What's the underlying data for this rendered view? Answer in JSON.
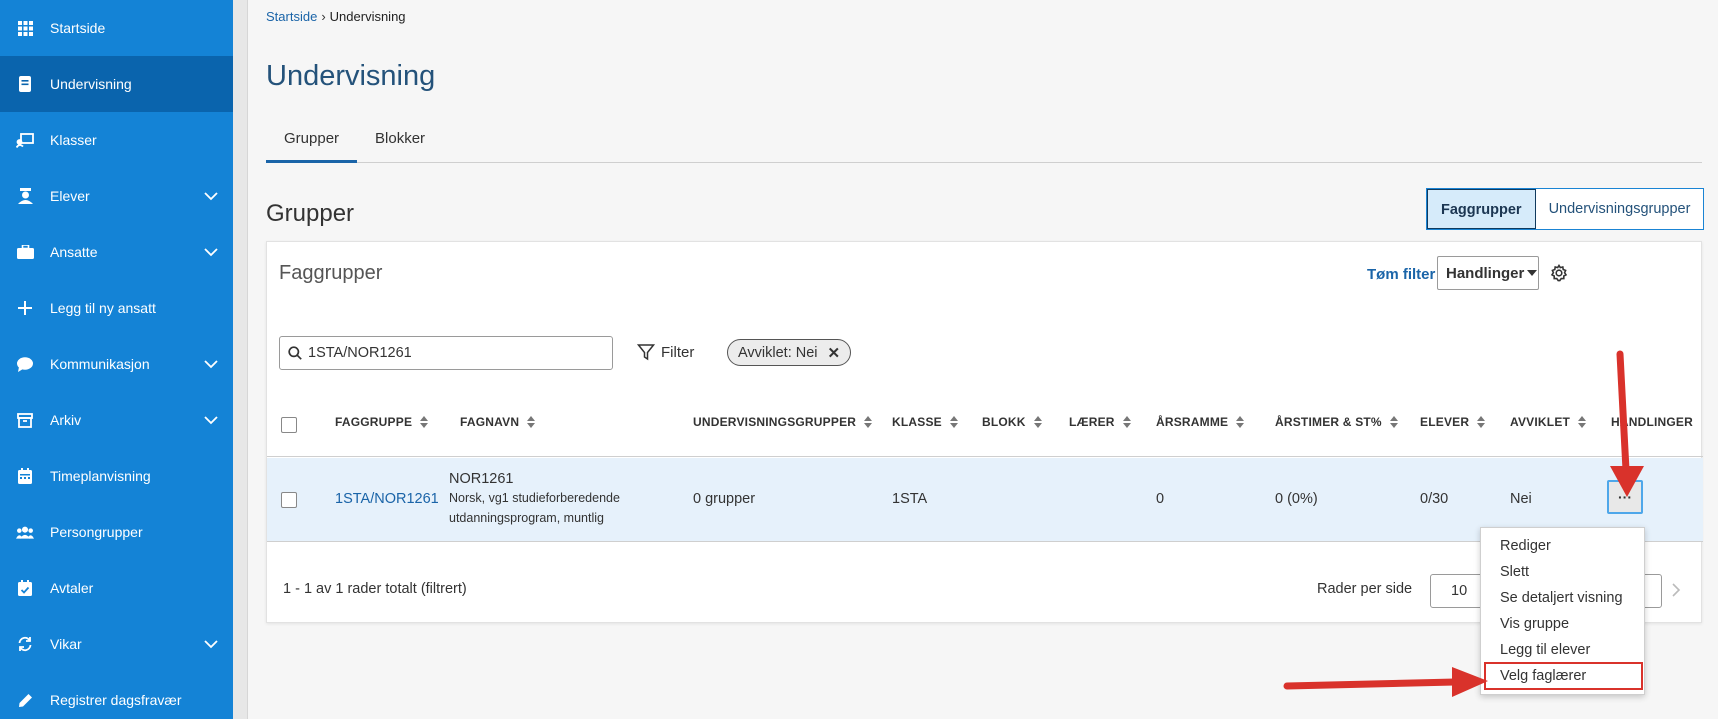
{
  "sidebar": {
    "items": [
      {
        "label": "Startside",
        "icon": "grid-icon",
        "active": false,
        "expandable": false
      },
      {
        "label": "Undervisning",
        "icon": "book-icon",
        "active": true,
        "expandable": false
      },
      {
        "label": "Klasser",
        "icon": "classroom-icon",
        "active": false,
        "expandable": false
      },
      {
        "label": "Elever",
        "icon": "student-icon",
        "active": false,
        "expandable": true
      },
      {
        "label": "Ansatte",
        "icon": "briefcase-icon",
        "active": false,
        "expandable": true
      },
      {
        "label": "Legg til ny ansatt",
        "icon": "plus-icon",
        "active": false,
        "expandable": false
      },
      {
        "label": "Kommunikasjon",
        "icon": "chat-icon",
        "active": false,
        "expandable": true
      },
      {
        "label": "Arkiv",
        "icon": "archive-icon",
        "active": false,
        "expandable": true
      },
      {
        "label": "Timeplanvisning",
        "icon": "calendar-icon",
        "active": false,
        "expandable": false
      },
      {
        "label": "Persongrupper",
        "icon": "people-icon",
        "active": false,
        "expandable": false
      },
      {
        "label": "Avtaler",
        "icon": "calendar-check-icon",
        "active": false,
        "expandable": false
      },
      {
        "label": "Vikar",
        "icon": "swap-icon",
        "active": false,
        "expandable": true
      },
      {
        "label": "Registrer dagsfravær",
        "icon": "pencil-icon",
        "active": false,
        "expandable": false
      }
    ]
  },
  "breadcrumb": {
    "home": "Startside",
    "current": "Undervisning"
  },
  "page_title": "Undervisning",
  "tabs": [
    {
      "label": "Grupper",
      "active": true
    },
    {
      "label": "Blokker",
      "active": false
    }
  ],
  "section_title": "Grupper",
  "view_toggle": {
    "faggrupper": "Faggrupper",
    "undervisningsgrupper": "Undervisningsgrupper",
    "selected": "Faggrupper"
  },
  "card": {
    "title": "Faggrupper",
    "clear_filter": "Tøm filter",
    "actions_label": "Handlinger",
    "search_value": "1STA/NOR1261",
    "filter_label": "Filter",
    "chip_label": "Avviklet: Nei"
  },
  "table": {
    "columns": [
      "FAGGRUPPE",
      "FAGNAVN",
      "UNDERVISNINGSGRUPPER",
      "KLASSE",
      "BLOKK",
      "LÆRER",
      "ÅRSRAMME",
      "ÅRSTIMER & ST%",
      "ELEVER",
      "AVVIKLET",
      "HANDLINGER"
    ],
    "rows": [
      {
        "faggruppe": "1STA/NOR1261",
        "fagnavn_code": "NOR1261",
        "fagnavn_desc1": "Norsk, vg1 studieforberedende",
        "fagnavn_desc2": "utdanningsprogram, muntlig",
        "undervisningsgrupper": "0 grupper",
        "klasse": "1STA",
        "blokk": "",
        "laerer": "",
        "arsramme": "0",
        "arstimer": "0 (0%)",
        "elever": "0/30",
        "avviklet": "Nei",
        "actions": "···"
      }
    ]
  },
  "footer": {
    "info": "1 - 1 av 1 rader totalt (filtrert)",
    "rows_per_page_label": "Rader per side",
    "rows_per_page_value": "10"
  },
  "row_menu": {
    "items": [
      "Rediger",
      "Slett",
      "Se detaljert visning",
      "Vis gruppe",
      "Legg til elever",
      "Velg faglærer"
    ],
    "highlighted": "Velg faglærer"
  },
  "colors": {
    "sidebar": "#1483d6",
    "sidebar_active": "#0a64ad",
    "link": "#1a64a8",
    "annotation": "#d9322b"
  }
}
